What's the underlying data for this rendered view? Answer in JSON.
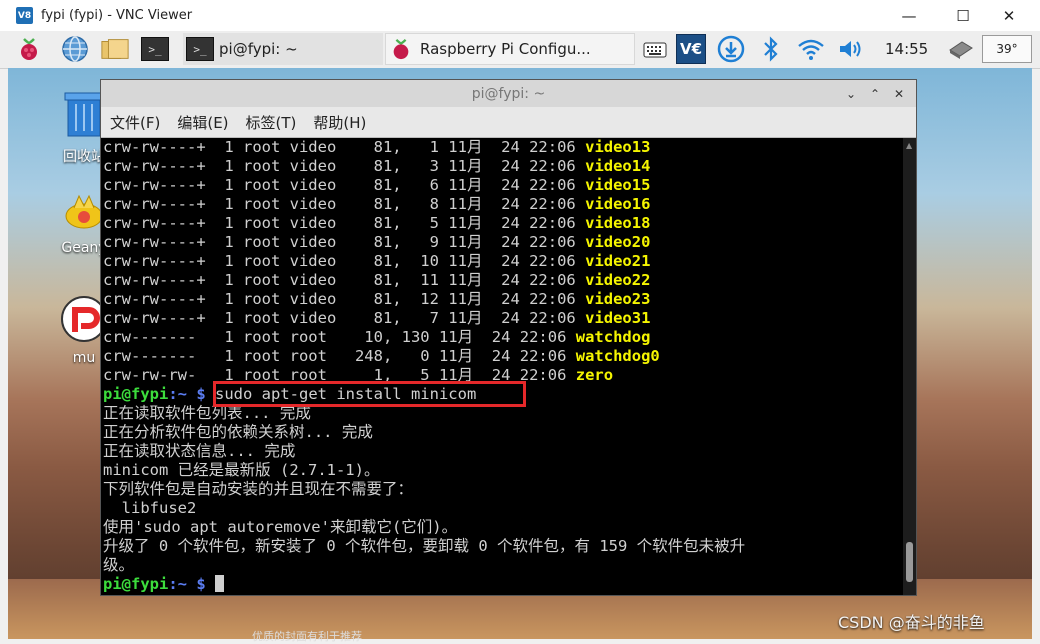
{
  "vnc": {
    "logo_text": "V8",
    "title": "fypi (fypi) - VNC Viewer",
    "minimize": "—",
    "maximize": "☐",
    "close": "✕"
  },
  "taskbar": {
    "terminal_task_label": "pi@fypi: ~",
    "rpi_config_task_label": "Raspberry Pi Configu...",
    "clock": "14:55",
    "cpu_temp": "39°",
    "icons": [
      "raspberry-menu-icon",
      "web-browser-icon",
      "file-manager-icon",
      "terminal-icon",
      "keyboard-icon",
      "vnc-icon",
      "download-icon",
      "bluetooth-icon",
      "wifi-icon",
      "volume-icon",
      "eject-icon"
    ]
  },
  "desktop": {
    "icons": [
      {
        "label": "回收站",
        "icon": "trash-icon"
      },
      {
        "label": "Geany",
        "icon": "geany-icon"
      },
      {
        "label": "mu",
        "icon": "mu-editor-icon"
      }
    ],
    "footer_hint": "优质的封面有利于推荐",
    "watermark": "CSDN @奋斗的非鱼"
  },
  "terminal": {
    "title": "pi@fypi: ~",
    "menu": [
      "文件(F)",
      "编辑(E)",
      "标签(T)",
      "帮助(H)"
    ],
    "device_rows": [
      {
        "perm": "crw-rw----+",
        "rest": "  1 root video    81,   1 11月  24 22:06 ",
        "name": "video13"
      },
      {
        "perm": "crw-rw----+",
        "rest": "  1 root video    81,   3 11月  24 22:06 ",
        "name": "video14"
      },
      {
        "perm": "crw-rw----+",
        "rest": "  1 root video    81,   6 11月  24 22:06 ",
        "name": "video15"
      },
      {
        "perm": "crw-rw----+",
        "rest": "  1 root video    81,   8 11月  24 22:06 ",
        "name": "video16"
      },
      {
        "perm": "crw-rw----+",
        "rest": "  1 root video    81,   5 11月  24 22:06 ",
        "name": "video18"
      },
      {
        "perm": "crw-rw----+",
        "rest": "  1 root video    81,   9 11月  24 22:06 ",
        "name": "video20"
      },
      {
        "perm": "crw-rw----+",
        "rest": "  1 root video    81,  10 11月  24 22:06 ",
        "name": "video21"
      },
      {
        "perm": "crw-rw----+",
        "rest": "  1 root video    81,  11 11月  24 22:06 ",
        "name": "video22"
      },
      {
        "perm": "crw-rw----+",
        "rest": "  1 root video    81,  12 11月  24 22:06 ",
        "name": "video23"
      },
      {
        "perm": "crw-rw----+",
        "rest": "  1 root video    81,   7 11月  24 22:06 ",
        "name": "video31"
      },
      {
        "perm": "crw-------  ",
        "rest": " 1 root root    10, 130 11月  24 22:06 ",
        "name": "watchdog"
      },
      {
        "perm": "crw-------  ",
        "rest": " 1 root root   248,   0 11月  24 22:06 ",
        "name": "watchdog0"
      },
      {
        "perm": "crw-rw-rw-  ",
        "rest": " 1 root root     1,   5 11月  24 22:06 ",
        "name": "zero"
      }
    ],
    "prompt_user": "pi@fypi",
    "prompt_path": ":~ $",
    "command": "sudo apt-get install minicom",
    "output_lines": [
      "正在读取软件包列表... 完成",
      "正在分析软件包的依赖关系树... 完成",
      "正在读取状态信息... 完成",
      "minicom 已经是最新版 (2.7.1-1)。",
      "下列软件包是自动安装的并且现在不需要了：",
      "  libfuse2",
      "使用'sudo apt autoremove'来卸载它(它们)。",
      "升级了 0 个软件包，新安装了 0 个软件包，要卸载 0 个软件包，有 159 个软件包未被升",
      "级。"
    ],
    "window_controls": [
      "⌄",
      "⌃",
      "✕"
    ]
  },
  "colors": {
    "prompt_green": "#3cdc3c",
    "prompt_blue": "#5b7df2",
    "device_yellow": "#f5f500",
    "highlight_red": "#e5282a"
  }
}
